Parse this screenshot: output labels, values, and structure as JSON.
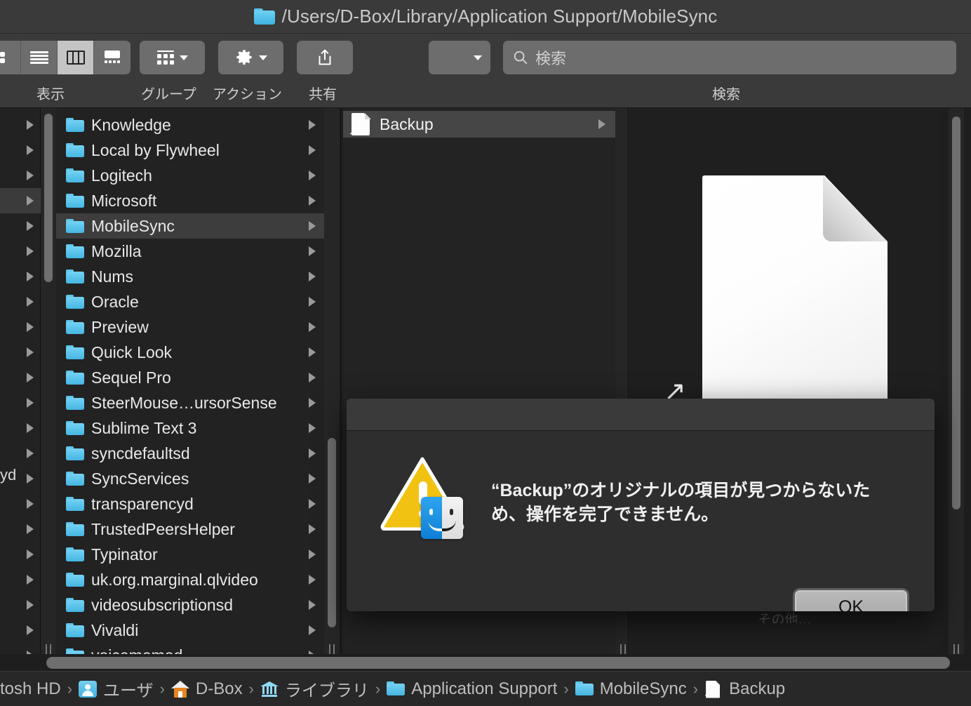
{
  "window": {
    "title": "/Users/D-Box/Library/Application Support/MobileSync",
    "title_icon": "folder-icon"
  },
  "toolbar": {
    "view_modes": [
      {
        "name": "icon-view",
        "icon": "icon-view-icon",
        "selected": false
      },
      {
        "name": "list-view",
        "icon": "list-view-icon",
        "selected": false
      },
      {
        "name": "column-view",
        "icon": "column-view-icon",
        "selected": true
      },
      {
        "name": "gallery-view",
        "icon": "gallery-view-icon",
        "selected": false
      }
    ],
    "group_icon": "grid-icon",
    "action_icon": "gear-icon",
    "share_icon": "share-icon",
    "labels": {
      "view": "表示",
      "group": "グループ",
      "action": "アクション",
      "share": "共有",
      "search": "検索"
    },
    "search": {
      "placeholder": "検索",
      "value": "",
      "icon": "search-icon"
    }
  },
  "columns": {
    "folder_list": [
      {
        "name": "Knowledge",
        "selected": false
      },
      {
        "name": "Local by Flywheel",
        "selected": false
      },
      {
        "name": "Logitech",
        "selected": false
      },
      {
        "name": "Microsoft",
        "selected": false
      },
      {
        "name": "MobileSync",
        "selected": true
      },
      {
        "name": "Mozilla",
        "selected": false
      },
      {
        "name": "Nums",
        "selected": false
      },
      {
        "name": "Oracle",
        "selected": false
      },
      {
        "name": "Preview",
        "selected": false
      },
      {
        "name": "Quick Look",
        "selected": false
      },
      {
        "name": "Sequel Pro",
        "selected": false
      },
      {
        "name": "SteerMouse…ursorSense",
        "selected": false
      },
      {
        "name": "Sublime Text 3",
        "selected": false
      },
      {
        "name": "syncdefaultsd",
        "selected": false
      },
      {
        "name": "SyncServices",
        "selected": false
      },
      {
        "name": "transparencyd",
        "selected": false
      },
      {
        "name": "TrustedPeersHelper",
        "selected": false
      },
      {
        "name": "Typinator",
        "selected": false
      },
      {
        "name": "uk.org.marginal.qlvideo",
        "selected": false
      },
      {
        "name": "videosubscriptionsd",
        "selected": false
      },
      {
        "name": "Vivaldi",
        "selected": false
      },
      {
        "name": "voicememod",
        "selected": false
      }
    ],
    "previous_column_stub": "yd",
    "detail_list": [
      {
        "name": "Backup",
        "icon": "alias-document-icon",
        "selected": true
      }
    ],
    "preview": {
      "icon": "alias-document-icon",
      "subtitle": "その他…"
    }
  },
  "path_bar": [
    {
      "label": "tosh HD",
      "icon": "none"
    },
    {
      "label": "ユーザ",
      "icon": "users-icon"
    },
    {
      "label": "D-Box",
      "icon": "home-icon"
    },
    {
      "label": "ライブラリ",
      "icon": "library-icon"
    },
    {
      "label": "Application Support",
      "icon": "folder-icon"
    },
    {
      "label": "MobileSync",
      "icon": "folder-icon"
    },
    {
      "label": "Backup",
      "icon": "alias-document-icon"
    }
  ],
  "dialog": {
    "icon": "warning-finder-icon",
    "message": "“Backup”のオリジナルの項目が見つからないため、操作を完了できません。",
    "ok_label": "OK"
  },
  "colors": {
    "accent_folder": "#45b6e2",
    "warning": "#f2c213",
    "window_bg": "#1e1e1e",
    "toolbar_bg": "#3a3a3a",
    "selection": "#3d3d3d"
  }
}
